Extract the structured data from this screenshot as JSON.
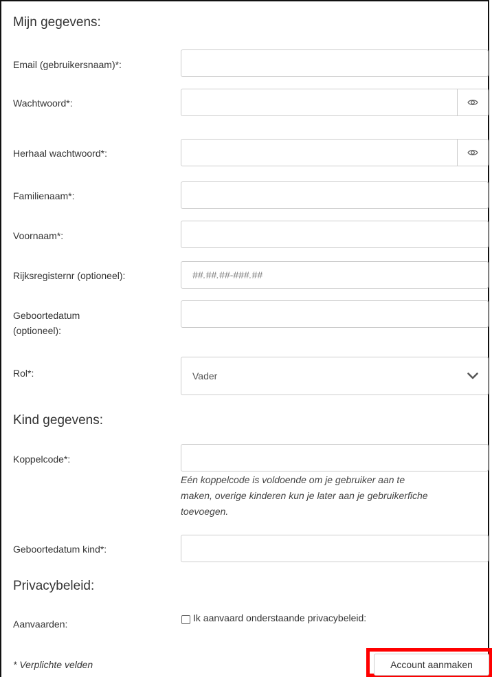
{
  "sections": {
    "mijn_gegevens": "Mijn gegevens:",
    "kind_gegevens": "Kind gegevens:",
    "privacy": "Privacybeleid:"
  },
  "fields": {
    "email": {
      "label": "Email (gebruikersnaam)*:",
      "value": ""
    },
    "password": {
      "label": "Wachtwoord*:",
      "value": "",
      "icon": "eye-icon"
    },
    "password_repeat": {
      "label": "Herhaal wachtwoord*:",
      "value": "",
      "icon": "eye-icon"
    },
    "lastname": {
      "label": "Familienaam*:",
      "value": ""
    },
    "firstname": {
      "label": "Voornaam*:",
      "value": ""
    },
    "national_id": {
      "label": "Rijksregisternr (optioneel):",
      "placeholder": "##.##.##-###.##"
    },
    "birthdate": {
      "label_line1": "Geboortedatum",
      "label_line2": "(optioneel):",
      "value": ""
    },
    "role": {
      "label": "Rol*:",
      "selected": "Vader",
      "icon": "chevron-down-icon"
    },
    "link_code": {
      "label": "Koppelcode*:",
      "value": "",
      "help_line1": "Eén koppelcode is voldoende om je gebruiker aan te",
      "help_line2": "maken, overige kinderen kun je later aan je gebruikerfiche",
      "help_line3": "toevoegen."
    },
    "child_birthdate": {
      "label": "Geboortedatum kind*:",
      "value": ""
    },
    "accept": {
      "label": "Aanvaarden:",
      "checkbox_label": "Ik aanvaard onderstaande privacybeleid:",
      "checked": false
    }
  },
  "footer": {
    "required_note": "* Verplichte velden",
    "submit_label": "Account aanmaken"
  },
  "colors": {
    "highlight": "#ff0000",
    "border": "#cccccc"
  }
}
